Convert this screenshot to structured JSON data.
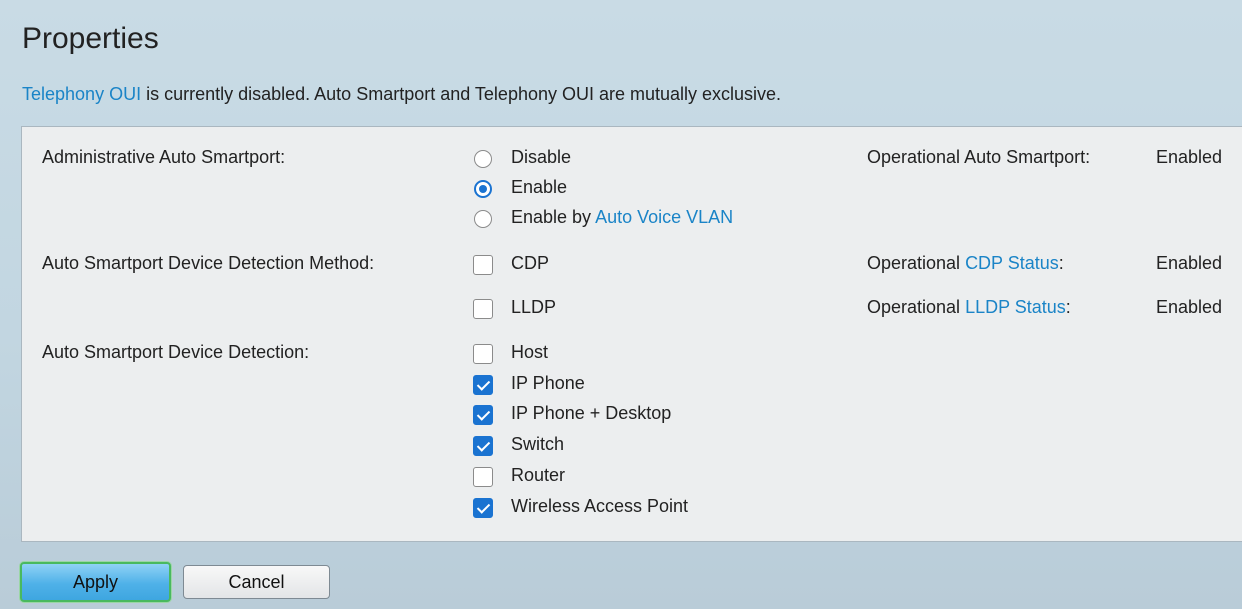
{
  "page": {
    "title": "Properties",
    "notice": {
      "link": "Telephony OUI",
      "text": " is currently disabled. Auto Smartport and Telephony OUI are mutually exclusive."
    }
  },
  "admin": {
    "label": "Administrative Auto Smartport:",
    "options": [
      {
        "label": "Disable",
        "selected": false
      },
      {
        "label": "Enable",
        "selected": true
      },
      {
        "prefix": "Enable by ",
        "link": "Auto Voice VLAN",
        "selected": false
      }
    ],
    "operational_label": "Operational Auto Smartport:",
    "operational_value": "Enabled"
  },
  "detection_method": {
    "label": "Auto Smartport Device Detection Method:",
    "options": [
      {
        "label": "CDP",
        "checked": false,
        "op_prefix": "Operational ",
        "op_link": "CDP Status",
        "op_suffix": ":",
        "op_value": "Enabled"
      },
      {
        "label": "LLDP",
        "checked": false,
        "op_prefix": "Operational ",
        "op_link": "LLDP Status",
        "op_suffix": ":",
        "op_value": "Enabled"
      }
    ]
  },
  "detection": {
    "label": "Auto Smartport Device Detection:",
    "options": [
      {
        "label": "Host",
        "checked": false
      },
      {
        "label": "IP Phone",
        "checked": true
      },
      {
        "label": "IP Phone + Desktop",
        "checked": true
      },
      {
        "label": "Switch",
        "checked": true
      },
      {
        "label": "Router",
        "checked": false
      },
      {
        "label": "Wireless Access Point",
        "checked": true
      }
    ]
  },
  "buttons": {
    "apply": "Apply",
    "cancel": "Cancel"
  },
  "colors": {
    "link": "#1a84c7",
    "accent": "#1a73d1",
    "apply_border": "#49b95f"
  }
}
